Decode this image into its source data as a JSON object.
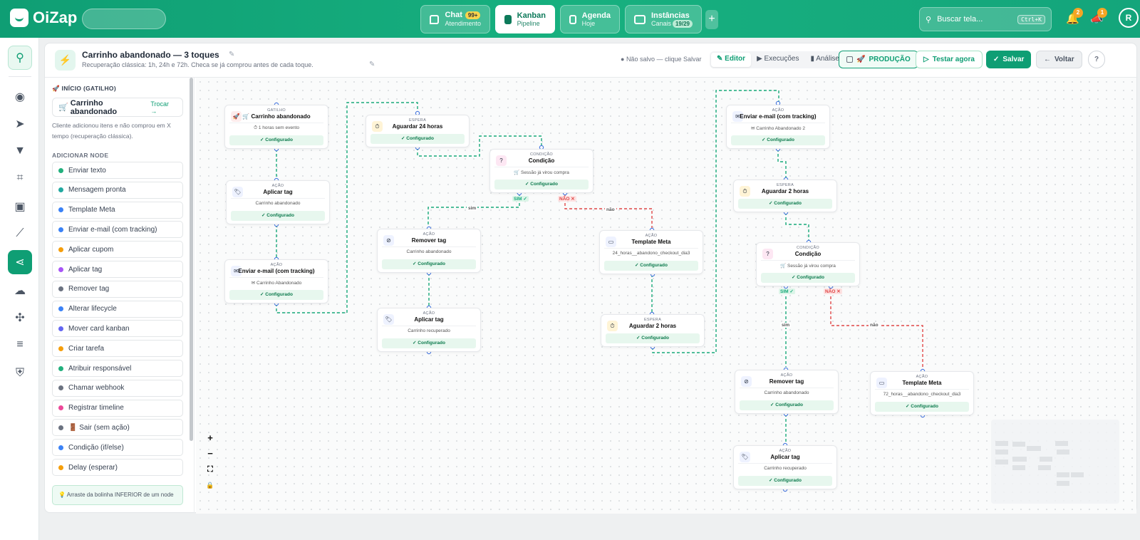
{
  "brand": {
    "name": "OiZap"
  },
  "topnav": {
    "tabs": [
      {
        "label": "Chat",
        "sub": "Atendimento",
        "badge": "99+"
      },
      {
        "label": "Kanban",
        "sub": "Pipeline"
      },
      {
        "label": "Agenda",
        "sub": "Hoje"
      },
      {
        "label": "Instâncias",
        "sub": "Canais",
        "badge": "19/29"
      }
    ],
    "add_label": "+",
    "search_placeholder": "Buscar tela...",
    "search_shortcut": "Ctrl+K",
    "notif_count": "2",
    "announce_count": "1",
    "avatar_initial": "R"
  },
  "flow": {
    "title": "Carrinho abandonado — 3 toques",
    "subtitle": "Recuperação clássica: 1h, 24h e 72h. Checa se já comprou antes de cada toque.",
    "save_status": "Não salvo — clique Salvar",
    "modes": [
      "Editor",
      "Execuções",
      "Análise"
    ],
    "production_label": "PRODUÇÃO",
    "test_label": "Testar agora",
    "save_label": "Salvar",
    "back_label": "Voltar",
    "help_label": "?"
  },
  "sidebar": {
    "start_title": "INÍCIO (GATILHO)",
    "trigger_name": "Carrinho abandonado",
    "trigger_change": "Trocar",
    "trigger_desc": "Cliente adicionou itens e não comprou em X tempo (recuperação clássica).",
    "add_title": "ADICIONAR NODE",
    "items": [
      {
        "label": "Enviar texto",
        "color": "#22b07d"
      },
      {
        "label": "Mensagem pronta",
        "color": "#22a9a0"
      },
      {
        "label": "Template Meta",
        "color": "#3b82f6"
      },
      {
        "label": "Enviar e-mail (com tracking)",
        "color": "#3b82f6"
      },
      {
        "label": "Aplicar cupom",
        "color": "#f59e0b"
      },
      {
        "label": "Aplicar tag",
        "color": "#a855f7"
      },
      {
        "label": "Remover tag",
        "color": "#6b7280"
      },
      {
        "label": "Alterar lifecycle",
        "color": "#3b82f6"
      },
      {
        "label": "Mover card kanban",
        "color": "#6366f1"
      },
      {
        "label": "Criar tarefa",
        "color": "#f59e0b"
      },
      {
        "label": "Atribuir responsável",
        "color": "#22b07d"
      },
      {
        "label": "Chamar webhook",
        "color": "#6b7280"
      },
      {
        "label": "Registrar timeline",
        "color": "#ec4899"
      },
      {
        "label": "🚪 Sair (sem ação)",
        "color": "#6b7280"
      },
      {
        "label": "Condição (if/else)",
        "color": "#3b82f6"
      },
      {
        "label": "Delay (esperar)",
        "color": "#f59e0b"
      }
    ],
    "hint": "Arraste da bolinha INFERIOR de um node"
  },
  "canvas": {
    "zoom_in": "+",
    "zoom_out": "−",
    "fit": "⛶",
    "lock": "🔒",
    "status_ok": "✓ Configurado",
    "nodes": [
      {
        "kind": "GATILHO",
        "title": "🛒 Carrinho abandonado",
        "sub": "⏱ 1 horas sem evento",
        "icon": "🚀"
      },
      {
        "kind": "AÇÃO",
        "title": "Aplicar tag",
        "sub": "Carrinho abandonado",
        "icon": "🏷"
      },
      {
        "kind": "AÇÃO",
        "title": "Enviar e-mail (com tracking)",
        "sub": "✉ Carrinho Abandonado",
        "icon": "✉"
      },
      {
        "kind": "ESPERA",
        "title": "Aguardar 24 horas",
        "sub": "",
        "icon": "⏱"
      },
      {
        "kind": "CONDIÇÃO",
        "title": "Condição",
        "sub": "🛒 Sessão já virou compra",
        "icon": "?"
      },
      {
        "kind": "AÇÃO",
        "title": "Remover tag",
        "sub": "Carrinho abandonado",
        "icon": "⊘"
      },
      {
        "kind": "AÇÃO",
        "title": "Aplicar tag",
        "sub": "Carrinho recuperado",
        "icon": "🏷"
      },
      {
        "kind": "AÇÃO",
        "title": "Template Meta",
        "sub": "24_horas__abandono_checkout_dia3",
        "icon": "▭"
      },
      {
        "kind": "ESPERA",
        "title": "Aguardar 2 horas",
        "sub": "",
        "icon": "⏱"
      },
      {
        "kind": "AÇÃO",
        "title": "Enviar e-mail (com tracking)",
        "sub": "✉ Carrinho Abandonado 2",
        "icon": "✉"
      },
      {
        "kind": "ESPERA",
        "title": "Aguardar 2 horas",
        "sub": "",
        "icon": "⏱"
      },
      {
        "kind": "CONDIÇÃO",
        "title": "Condição",
        "sub": "🛒 Sessão já virou compra",
        "icon": "?"
      },
      {
        "kind": "AÇÃO",
        "title": "Remover tag",
        "sub": "Carrinho abandonado",
        "icon": "⊘"
      },
      {
        "kind": "AÇÃO",
        "title": "Template Meta",
        "sub": "72_horas__abandono_checkout_dia3",
        "icon": "▭"
      },
      {
        "kind": "AÇÃO",
        "title": "Aplicar tag",
        "sub": "Carrinho recuperado",
        "icon": "🏷"
      }
    ],
    "edge_labels": {
      "yes_port": "SIM ✓",
      "no_port": "NÃO ✕",
      "yes": "sim",
      "no": "não"
    }
  }
}
